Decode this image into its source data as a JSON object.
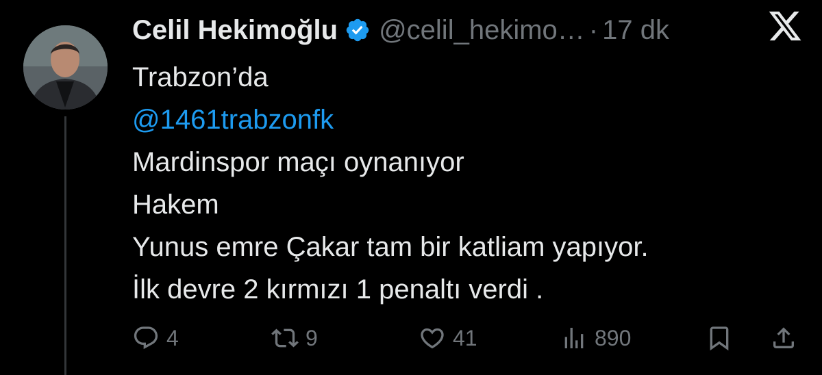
{
  "author": {
    "display_name": "Celil Hekimoğlu",
    "handle": "@celil_hekimo…",
    "separator": "·",
    "time": "17 dk",
    "avatar_icon": "profile-photo",
    "verified_icon": "verified-badge-icon"
  },
  "platform": {
    "logo_icon": "x-logo-icon"
  },
  "tweet": {
    "lines": [
      {
        "text": "Trabzon’da",
        "type": "text"
      },
      {
        "text": "@1461trabzonfk",
        "type": "mention"
      },
      {
        "text": "Mardinspor maçı oynanıyor",
        "type": "text"
      },
      {
        "text": "Hakem",
        "type": "text"
      },
      {
        "text": "Yunus emre Çakar tam bir katliam yapıyor.",
        "type": "text"
      },
      {
        "text": "İlk devre 2 kırmızı 1 penaltı verdi .",
        "type": "text"
      }
    ]
  },
  "actions": {
    "reply": {
      "icon": "reply-icon",
      "count": "4"
    },
    "repost": {
      "icon": "repost-icon",
      "count": "9"
    },
    "like": {
      "icon": "heart-icon",
      "count": "41"
    },
    "views": {
      "icon": "views-icon",
      "count": "890"
    },
    "bookmark": {
      "icon": "bookmark-icon"
    },
    "share": {
      "icon": "share-icon"
    }
  },
  "colors": {
    "background": "#000000",
    "text": "#e7e9ea",
    "muted": "#71767b",
    "accent": "#1d9bf0",
    "thread_line": "#333639"
  }
}
